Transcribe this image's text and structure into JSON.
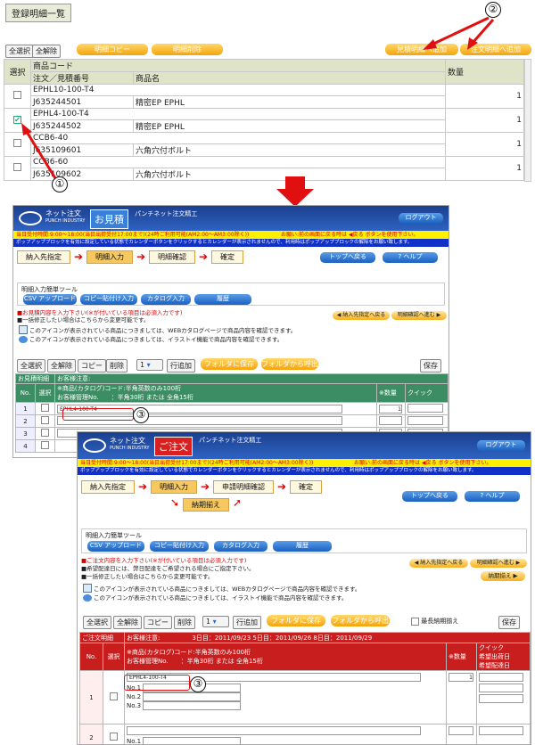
{
  "top": {
    "title": "登録明細一覧",
    "select_all": "全選択",
    "deselect_all": "全解除",
    "copy": "明細コピー",
    "delete": "明細削除",
    "to_quote": "見積明細へ追加",
    "to_order": "注文明細へ追加",
    "col_select": "選択",
    "col_code": "商品コード",
    "col_code2": "注文／見積番号",
    "col_name": "商品名",
    "col_qty": "数量",
    "rows": [
      {
        "code": "EPHL10-100-T4",
        "no": "J635244501",
        "name": "精密EP EPHL",
        "qty": "1"
      },
      {
        "code": "EPHL4-100-T4",
        "no": "J635244502",
        "name": "精密EP EPHL",
        "qty": "1"
      },
      {
        "code": "CCB6-40",
        "no": "J635109601",
        "name": "六角穴付ボルト",
        "qty": "1"
      },
      {
        "code": "CCB6-60",
        "no": "J635109602",
        "name": "六角穴付ボルト",
        "qty": "1"
      }
    ]
  },
  "quote": {
    "logo": "ネット注文",
    "logo_sub": "PUNCH INDUSTRY",
    "badge": "お見積",
    "subtitle": "パンチネット注文精工",
    "logout": "ログアウト",
    "notice1": "当日受付時間:9:00〜18:00(当日出荷受付17:00まで)(24時ご利用可能(AM2:00〜AM3:00除く))",
    "notice1b": "お願い:前の画面に戻る時は ◀戻る ボタンを使用下さい。",
    "notice2": "ポップアップブロックを有効に設定している状態でカレンダーボタンをクリックするとカレンダーが表示されませんので、利用時はポップアップブロックの解除をお願い致します。",
    "steps": [
      "納入先指定",
      "明細入力",
      "明細確認",
      "確定"
    ],
    "top_btn": "トップへ戻る",
    "help_btn": "? ヘルプ",
    "tool_title": "明細入力簡単ツール",
    "tools": [
      "CSV アップロード",
      "コピー貼付け入力",
      "カタログ入力",
      "履歴"
    ],
    "note1": "■お見積内容を入力下さい(※が付いている項目は必須入力です)",
    "note2": "■一括修正したい場合はこちらから変更可能です。",
    "note3": "このアイコンが表示されている商品につきましては、WEBカタログページで商品内容を確認できます。",
    "note4": "このアイコンが表示されている商品につきましては、イラストイ機能で商品内容を確認できます。",
    "back_btn": "◀ 納入先指定へ戻る",
    "next_btn": "明細確認へ進む ▶",
    "btn_selall": "全選択",
    "btn_desel": "全解除",
    "btn_copy": "コピー",
    "btn_del": "削除",
    "sel_val": "1",
    "btn_addrow": "行追加",
    "btn_savef": "フォルダに保存",
    "btn_loadf": "フォルダから呼出",
    "btn_save": "保存",
    "sec_label": "お見積明細",
    "cust_note": "お客様注意:",
    "col_no": "No.",
    "col_sel": "選択",
    "col_prod": "※商品(カタログ)コード:半角英数のみ100桁",
    "col_mgmt": "お客様管理No.　　：半角30桁 または 全角15桁",
    "col_qty": "※数量",
    "col_quick": "クイック",
    "rows": [
      {
        "no": "1",
        "code": "EPHL4-100-T4",
        "qty": "1"
      },
      {
        "no": "2",
        "code": "",
        "qty": ""
      },
      {
        "no": "3",
        "code": "",
        "qty": ""
      },
      {
        "no": "4",
        "code": "",
        "qty": ""
      }
    ]
  },
  "order": {
    "logo": "ネット注文",
    "logo_sub": "PUNCH INDUSTRY",
    "badge": "ご注文",
    "subtitle": "パンチネット注文精工",
    "logout": "ログアウト",
    "notice1": "当日受付時間:9:00〜18:00(当日出荷受付17:00まで)(24時ご利用可能(AM2:00〜AM3:00除く))",
    "notice1b": "お願い:前の画面に戻る時は ◀戻る ボタンを使用下さい。",
    "notice2": "ポップアップブロックを有効に設定している状態でカレンダーボタンをクリックするとカレンダーが表示されませんので、利用時はポップアップブロックの解除をお願い致します。",
    "steps": [
      "納入先指定",
      "明細入力",
      "申請明細確認",
      "確定"
    ],
    "sub_step": "納期揃え",
    "top_btn": "トップへ戻る",
    "help_btn": "? ヘルプ",
    "tool_title": "明細入力簡単ツール",
    "tools": [
      "CSV アップロード",
      "コピー貼付け入力",
      "カタログ入力",
      "履歴"
    ],
    "note1": "■ご注文内容を入力下さい(※が付いている項目は必須入力です)",
    "note2": "■希望配達日には、弊日配達をご希望される場合にご指定下さい。",
    "note3": "■一括修正したい場合はこちらから変更可能です。",
    "note4": "このアイコンが表示されている商品につきましては、WEBカタログページで商品内容を確認できます。",
    "note5": "このアイコンが表示されている商品につきましては、イラストイ機能で商品内容を確認できます。",
    "back_btn": "◀ 納入先指定へ戻る",
    "next_btn": "明細確認へ進む ▶",
    "nouki_btn": "納期揃え ▶",
    "btn_selall": "全選択",
    "btn_desel": "全解除",
    "btn_copy": "コピー",
    "btn_del": "削除",
    "sel_val": "1",
    "btn_addrow": "行追加",
    "btn_savef": "フォルダに保存",
    "btn_loadf": "フォルダから呼出",
    "chk_label": "最長納期揃え",
    "btn_save": "保存",
    "sec_label": "ご注文明細",
    "cust_note": "お客様注意:",
    "cust_dates": "3日目：2011/09/23 5日目：2011/09/26 8日目：2011/09/29",
    "col_no": "No.",
    "col_sel": "選択",
    "col_prod": "※商品(カタログ)コード:半角英数のみ100桁",
    "col_mgmt": "お客様管理No.　　：半角30桁 または 全角15桁",
    "col_qty": "※数量",
    "col_quick": "クイック",
    "col_ship": "希望出荷日",
    "col_deliv": "希望配達日",
    "row1": {
      "no": "1",
      "code": "EPHL4-100-T4",
      "qty": "1",
      "sub": [
        "No.1",
        "No.2",
        "No.3"
      ]
    },
    "row2": {
      "no": "2",
      "sub": [
        "No.1"
      ]
    }
  },
  "markers": {
    "m1": "①",
    "m2": "②",
    "m3": "③"
  }
}
